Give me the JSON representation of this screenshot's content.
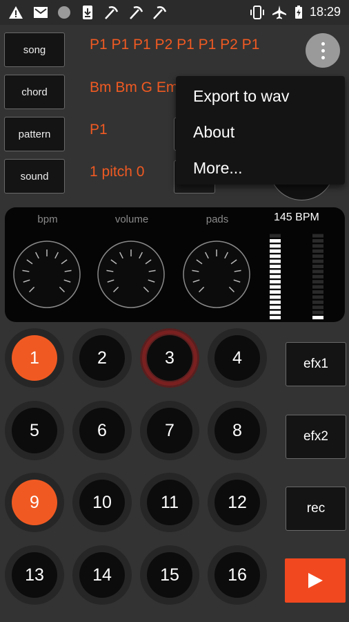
{
  "status_bar": {
    "time": "18:29",
    "icons": [
      "warning-icon",
      "mail-icon",
      "circle-icon",
      "download-icon",
      "pickaxe-icon",
      "pickaxe-icon",
      "pickaxe-icon",
      "vibrate-icon",
      "airplane-icon",
      "battery-charging-icon"
    ]
  },
  "nav": {
    "song": "song",
    "chord": "chord",
    "pattern": "pattern",
    "sound": "sound"
  },
  "sequence": {
    "song": "P1 P1 P1 P2 P1 P1 P2 P1",
    "chord": "Bm Bm G Em",
    "pattern": "P1",
    "sound": "1 pitch 0"
  },
  "menu": {
    "items": [
      "Export to wav",
      "About",
      "More..."
    ]
  },
  "controls": {
    "bpm_label": "bpm",
    "volume_label": "volume",
    "pads_label": "pads",
    "bpm_value": "145 BPM",
    "meter_left_level": 0.94,
    "meter_right_level": 0.06
  },
  "pads": [
    "1",
    "2",
    "3",
    "4",
    "5",
    "6",
    "7",
    "8",
    "9",
    "10",
    "11",
    "12",
    "13",
    "14",
    "15",
    "16"
  ],
  "side": {
    "efx1": "efx1",
    "efx2": "efx2",
    "rec": "rec"
  },
  "colors": {
    "accent": "#f05a22",
    "background": "#333333"
  }
}
